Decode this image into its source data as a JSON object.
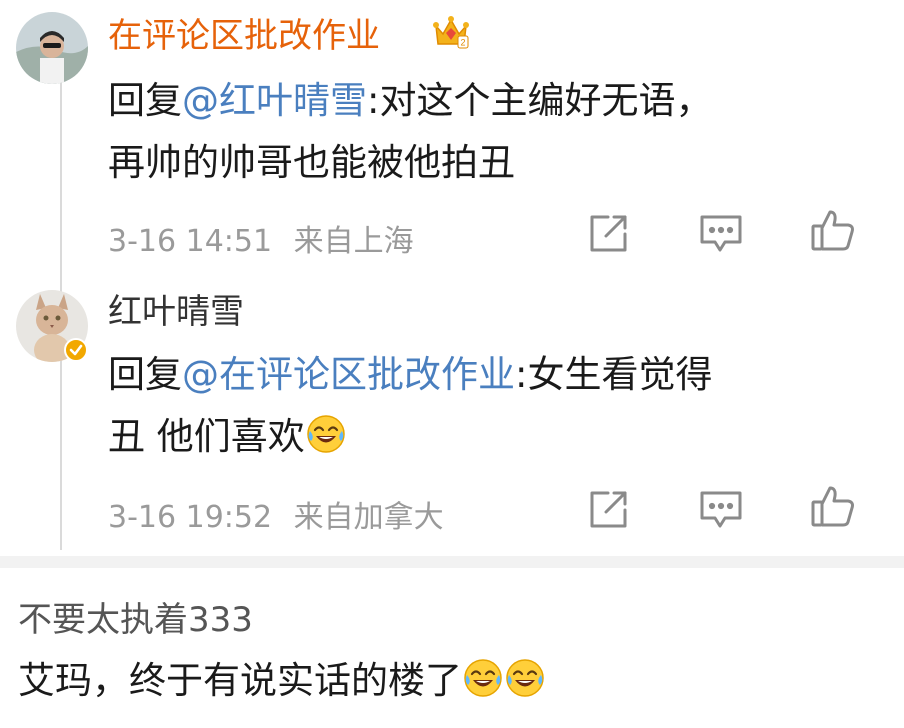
{
  "replies": [
    {
      "username": "在评论区批改作业",
      "prefix": "回复",
      "mention": "@红叶晴雪",
      "text_line1": ":对这个主编好无语，",
      "text_line2": "再帅的帅哥也能被他拍丑",
      "time": "3-16 14:51",
      "location": "来自上海"
    },
    {
      "username": "红叶晴雪",
      "prefix": "回复",
      "mention": "@在评论区批改作业",
      "text_line1": ":女生看觉得",
      "text_line2": "丑 他们喜欢",
      "time": "3-16 19:52",
      "location": "来自加拿大"
    }
  ],
  "next_comment": {
    "username": "不要太执着333",
    "text": "艾玛，终于有说实话的楼了"
  },
  "icons": {
    "share": "share-icon",
    "comment": "comment-icon",
    "like": "thumbs-up-icon",
    "crown": "crown-badge-icon",
    "verified": "verified-badge-icon",
    "emoji": "laughing-tears-emoji"
  },
  "colors": {
    "accent_orange": "#e6620a",
    "mention_blue": "#4a7fbf",
    "meta_gray": "#9a9a9a"
  }
}
